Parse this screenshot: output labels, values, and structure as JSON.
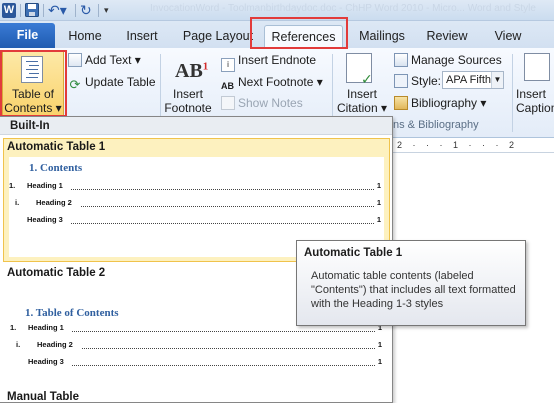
{
  "title_bar": {
    "app_icon_letter": "W",
    "faint_title": "InvocationWord - Toolmanbirthdaydoc.doc - ChHP Word 2010 - Micro... Word and Style"
  },
  "tabs": [
    "File",
    "Home",
    "Insert",
    "Page Layout",
    "References",
    "Mailings",
    "Review",
    "View"
  ],
  "ribbon": {
    "toc_label_line1": "Table of",
    "toc_label_line2": "Contents ▾",
    "add_text": "Add Text ▾",
    "update_table": "Update Table",
    "insert_footnote_line1": "Insert",
    "insert_footnote_line2": "Footnote",
    "insert_endnote": "Insert Endnote",
    "next_footnote": "Next Footnote ▾",
    "show_notes": "Show Notes",
    "insert_citation_line1": "Insert",
    "insert_citation_line2": "Citation ▾",
    "manage_sources": "Manage Sources",
    "style_label": "Style:",
    "style_value": "APA Fifth",
    "bibliography": "Bibliography ▾",
    "insert_caption_line1": "Insert",
    "insert_caption_line2": "Caption",
    "group_citations": "ns & Bibliography"
  },
  "ruler": "2 · · · 1 · · · 2",
  "gallery": {
    "header": "Built-In",
    "items": [
      {
        "title": "Automatic Table 1",
        "heading": "1.  Contents",
        "lines": [
          {
            "num": "1.",
            "label": "Heading 1",
            "page": "1"
          },
          {
            "num": "i.",
            "label": "Heading 2",
            "page": "1"
          },
          {
            "num": "",
            "label": "Heading 3",
            "page": "1"
          }
        ]
      },
      {
        "title": "Automatic Table 2",
        "heading": "1.  Table of Contents",
        "lines": [
          {
            "num": "1.",
            "label": "Heading 1",
            "page": "1"
          },
          {
            "num": "i.",
            "label": "Heading 2",
            "page": "1"
          },
          {
            "num": "",
            "label": "Heading 3",
            "page": "1"
          }
        ]
      },
      {
        "title": "Manual Table"
      }
    ]
  },
  "tooltip": {
    "title": "Automatic Table 1",
    "body": "Automatic table contents (labeled \"Contents\") that includes all text formatted with the Heading 1-3 styles"
  }
}
